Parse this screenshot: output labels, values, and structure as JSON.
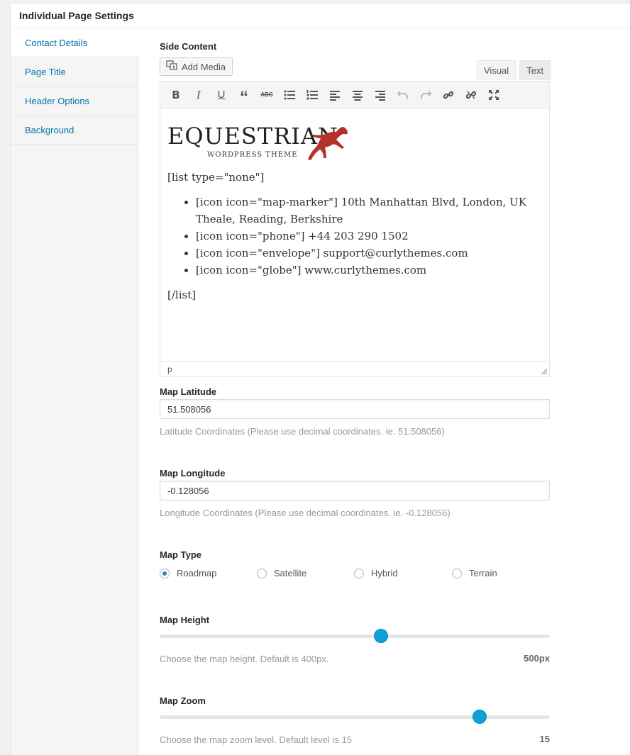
{
  "metabox": {
    "title": "Individual Page Settings"
  },
  "sidebar": {
    "items": [
      {
        "label": "Contact Details",
        "active": true
      },
      {
        "label": "Page Title"
      },
      {
        "label": "Header Options"
      },
      {
        "label": "Background"
      }
    ]
  },
  "side_content": {
    "label": "Side Content",
    "add_media_label": "Add Media",
    "tabs": {
      "visual": "Visual",
      "text": "Text"
    },
    "logo": {
      "title": "EQUESTRIAN",
      "subtitle": "WORDPRESS THEME",
      "horse_color": "#b5322a"
    },
    "content": {
      "list_open": "[list type=\"none\"]",
      "items": [
        "[icon icon=\"map-marker\"] 10th Manhattan Blvd, London, UK Theale, Reading, Berkshire",
        "[icon icon=\"phone\"] +44 203 290 1502",
        "[icon icon=\"envelope\"] support@curlythemes.com",
        "[icon icon=\"globe\"] www.curlythemes.com"
      ],
      "list_close": "[/list]"
    },
    "status_path": "p"
  },
  "map_latitude": {
    "label": "Map Latitude",
    "value": "51.508056",
    "description": "Latitude Coordinates (Please use decimal coordinates. ie. 51.508056)"
  },
  "map_longitude": {
    "label": "Map Longitude",
    "value": "-0.128056",
    "description": "Longitude Coordinates (Please use decimal coordinates. ie. -0.128056)"
  },
  "map_type": {
    "label": "Map Type",
    "options": [
      "Roadmap",
      "Satellite",
      "Hybrid",
      "Terrain"
    ],
    "selected": "Roadmap"
  },
  "map_height": {
    "label": "Map Height",
    "description": "Choose the map height. Default is 400px.",
    "value_text": "500px",
    "fraction": 0.567
  },
  "map_zoom": {
    "label": "Map Zoom",
    "description": "Choose the map zoom level. Default level is 15",
    "value_text": "15",
    "fraction": 0.82
  },
  "colors": {
    "link": "#0073aa",
    "accent": "#0ea0d6",
    "radio_dot": "#1e8cbe"
  }
}
